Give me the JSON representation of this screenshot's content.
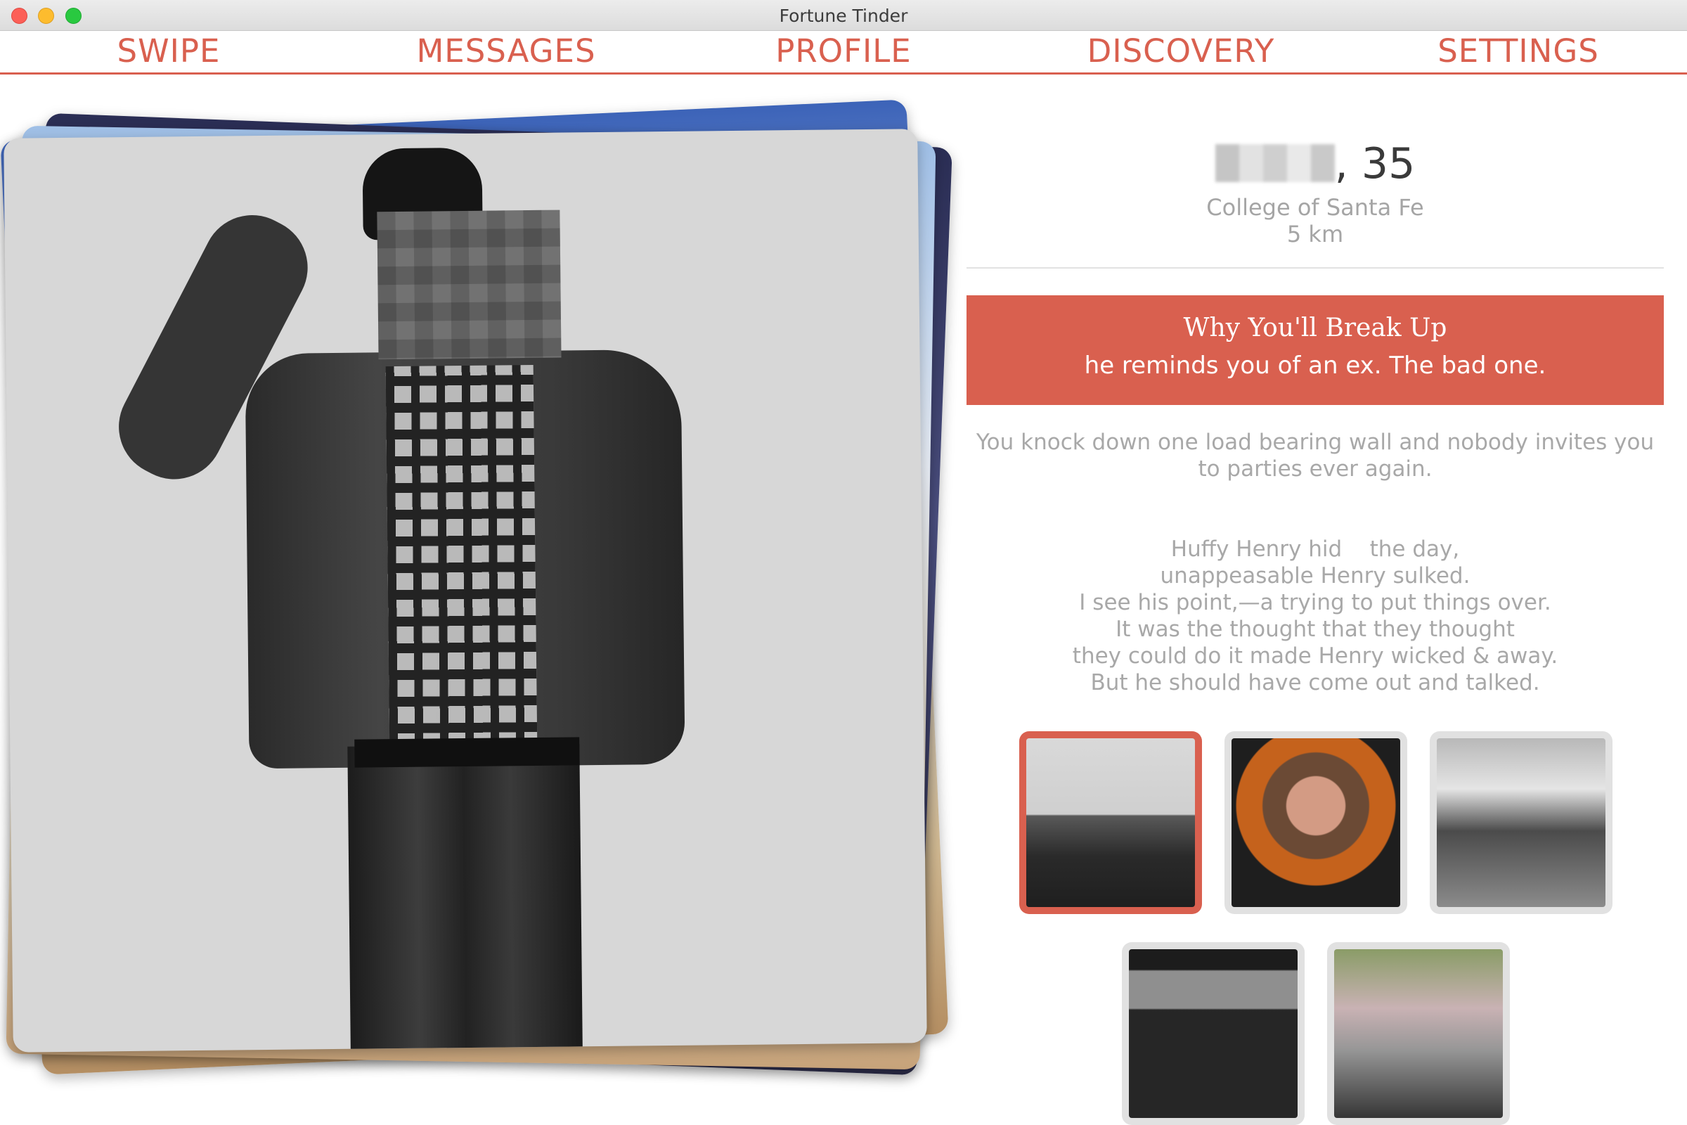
{
  "window": {
    "title": "Fortune Tinder"
  },
  "nav": {
    "items": [
      {
        "label": "SWIPE"
      },
      {
        "label": "MESSAGES"
      },
      {
        "label": "PROFILE"
      },
      {
        "label": "DISCOVERY"
      },
      {
        "label": "SETTINGS"
      }
    ]
  },
  "profile": {
    "age_suffix": ", 35",
    "school": "College of Santa Fe",
    "distance": "5 km",
    "fortune": {
      "title": "Why You'll Break Up",
      "text": "he reminds you of an ex. The bad one."
    },
    "bio": [
      "You knock down one load bearing wall and nobody invites you",
      "to parties ever again."
    ],
    "poem": [
      "Huffy Henry hid    the day,",
      "unappeasable Henry sulked.",
      "I see his point,—a trying to put things over.",
      "It was the thought that they thought",
      "they could do it made Henry wicked & away.",
      "But he should have come out and talked."
    ],
    "photos": [
      {
        "selected": true
      },
      {
        "selected": false
      },
      {
        "selected": false
      },
      {
        "selected": false
      },
      {
        "selected": false
      }
    ]
  },
  "colors": {
    "accent": "#d9604f",
    "muted_text": "#a8a8a8"
  }
}
